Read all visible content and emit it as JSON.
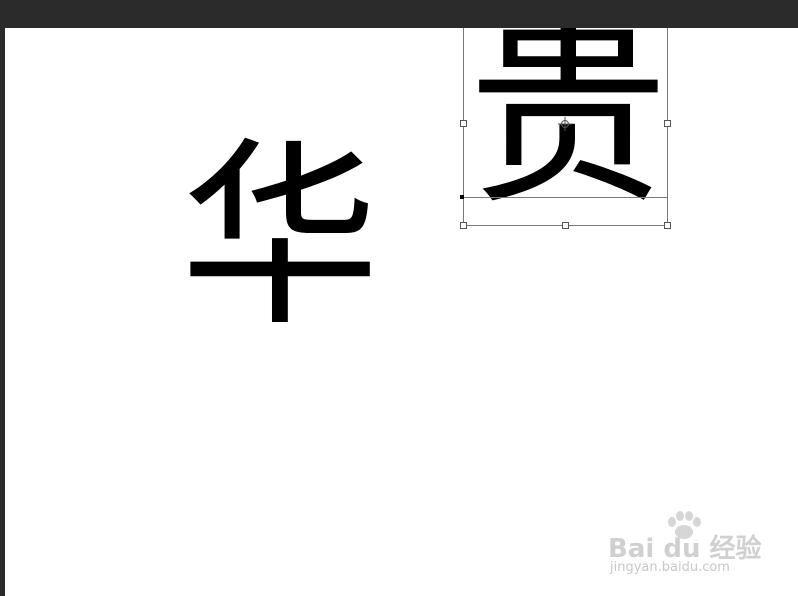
{
  "canvas": {
    "characters": [
      "华",
      "贵"
    ]
  },
  "watermark": {
    "brand": "Bai du 经验",
    "url": "jingyan.baidu.com",
    "icon": "paw-icon"
  },
  "colors": {
    "workspace": "#282828",
    "canvas": "#ffffff",
    "text": "#000000",
    "watermark": "#d0d0d0"
  }
}
